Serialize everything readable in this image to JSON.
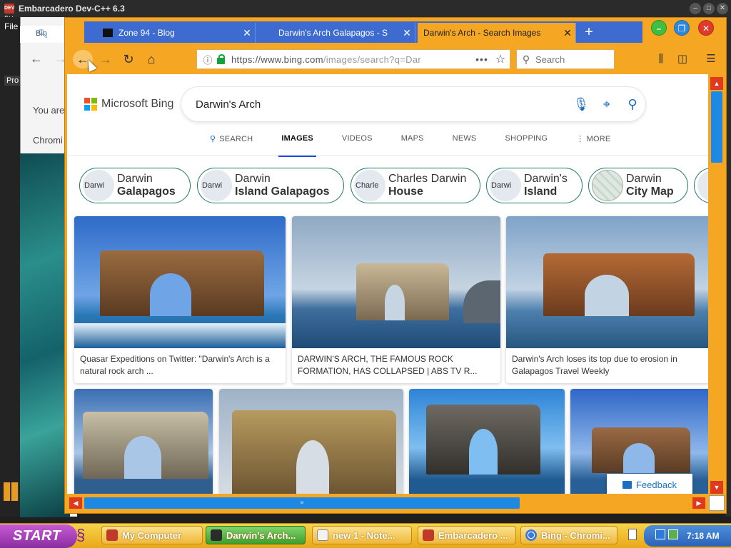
{
  "devcpp": {
    "title": "Embarcadero Dev-C++ 6.3",
    "logo_text": "DEV C++",
    "menu_file": "File",
    "panel_label": "Pro"
  },
  "chrome_bg": {
    "tab_label": "Bin",
    "text_line1": "You are",
    "text_line2": "Chromi"
  },
  "firefox": {
    "tabs": [
      {
        "label": "Zone 94 - Blog"
      },
      {
        "label": "Darwin's Arch Galapagos - S"
      },
      {
        "label": "Darwin's Arch - Search Images"
      }
    ],
    "new_tab_label": "+",
    "close_label": "✕",
    "url_main": "https://www.bing.com",
    "url_rest": "/images/search?q=Dar",
    "url_more": "•••",
    "search_placeholder": "Search"
  },
  "bing": {
    "brand": "Microsoft Bing",
    "query": "Darwin's Arch",
    "nav": [
      {
        "label": "SEARCH"
      },
      {
        "label": "IMAGES"
      },
      {
        "label": "VIDEOS"
      },
      {
        "label": "MAPS"
      },
      {
        "label": "NEWS"
      },
      {
        "label": "SHOPPING"
      },
      {
        "label": "⋮ MORE"
      }
    ],
    "chips": [
      {
        "thumb": "Darwi",
        "line1": "Darwin",
        "line2": "Galapagos"
      },
      {
        "thumb": "Darwi",
        "line1": "Darwin",
        "line2": "Island Galapagos"
      },
      {
        "thumb": "Charle",
        "line1": "Charles Darwin",
        "line2": "House"
      },
      {
        "thumb": "Darwi",
        "line1": "Darwin's",
        "line2": "Island"
      },
      {
        "thumb": "",
        "line1": "Darwin",
        "line2": "City Map"
      }
    ],
    "results_row1": [
      {
        "caption": "Quasar Expeditions on Twitter: \"Darwin's Arch is a natural rock arch ..."
      },
      {
        "caption": "DARWIN'S ARCH, THE FAMOUS ROCK FORMATION, HAS COLLAPSED | ABS TV R..."
      },
      {
        "caption": "Darwin's Arch loses its top due to erosion in Galapagos Travel Weekly"
      }
    ],
    "feedback": "Feedback"
  },
  "scrollbar": {
    "up": "▲",
    "down": "▼",
    "left": "◀",
    "right": "▶",
    "grip": "≡"
  },
  "taskbar": {
    "start": "START",
    "buttons": [
      {
        "label": "My Computer"
      },
      {
        "label": "Darwin's Arch..."
      },
      {
        "label": "new 1 - Note..."
      },
      {
        "label": "Embarcadero ..."
      },
      {
        "label": "Bing - Chromi..."
      }
    ],
    "time": "7:18 AM"
  },
  "colors": {
    "firefox_frame": "#f5a623",
    "firefox_tabstrip": "#3d6bd0",
    "bing_accent": "#174ae4",
    "chip_border": "#1f7a6a",
    "taskbar": "#f0b739",
    "start_button": "#a23cb8",
    "scroll_thumb": "#1e88e5",
    "scroll_arrow": "#e03a1e"
  }
}
